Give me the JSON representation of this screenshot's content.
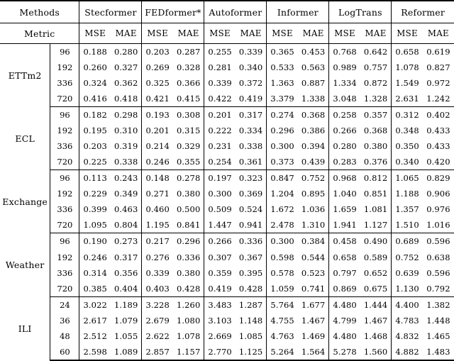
{
  "table": {
    "corner_label": "Methods",
    "metric_row_label": "Metric",
    "models": [
      "Stecformer",
      "FEDformer*",
      "Autoformer",
      "Informer",
      "LogTrans",
      "Reformer"
    ],
    "metrics": [
      "MSE",
      "MAE"
    ],
    "blocks": [
      {
        "dataset": "ETTm2",
        "rows": [
          {
            "horizon": "96",
            "values": [
              "0.188",
              "0.280",
              "0.203",
              "0.287",
              "0.255",
              "0.339",
              "0.365",
              "0.453",
              "0.768",
              "0.642",
              "0.658",
              "0.619"
            ],
            "bold": [
              true,
              true,
              false,
              false,
              false,
              false,
              false,
              false,
              false,
              false,
              false,
              false
            ]
          },
          {
            "horizon": "192",
            "values": [
              "0.260",
              "0.327",
              "0.269",
              "0.328",
              "0.281",
              "0.340",
              "0.533",
              "0.563",
              "0.989",
              "0.757",
              "1.078",
              "0.827"
            ],
            "bold": [
              true,
              true,
              false,
              false,
              false,
              false,
              false,
              false,
              false,
              false,
              false,
              false
            ]
          },
          {
            "horizon": "336",
            "values": [
              "0.324",
              "0.362",
              "0.325",
              "0.366",
              "0.339",
              "0.372",
              "1.363",
              "0.887",
              "1.334",
              "0.872",
              "1.549",
              "0.972"
            ],
            "bold": [
              true,
              true,
              false,
              false,
              false,
              false,
              false,
              false,
              false,
              false,
              false,
              false
            ]
          },
          {
            "horizon": "720",
            "values": [
              "0.416",
              "0.418",
              "0.421",
              "0.415",
              "0.422",
              "0.419",
              "3.379",
              "1.338",
              "3.048",
              "1.328",
              "2.631",
              "1.242"
            ],
            "bold": [
              true,
              false,
              false,
              true,
              false,
              false,
              false,
              false,
              false,
              false,
              false,
              false
            ]
          }
        ]
      },
      {
        "dataset": "ECL",
        "rows": [
          {
            "horizon": "96",
            "values": [
              "0.182",
              "0.298",
              "0.193",
              "0.308",
              "0.201",
              "0.317",
              "0.274",
              "0.368",
              "0.258",
              "0.357",
              "0.312",
              "0.402"
            ],
            "bold": [
              true,
              true,
              false,
              false,
              false,
              false,
              false,
              false,
              false,
              false,
              false,
              false
            ]
          },
          {
            "horizon": "192",
            "values": [
              "0.195",
              "0.310",
              "0.201",
              "0.315",
              "0.222",
              "0.334",
              "0.296",
              "0.386",
              "0.266",
              "0.368",
              "0.348",
              "0.433"
            ],
            "bold": [
              true,
              true,
              false,
              false,
              false,
              false,
              false,
              false,
              false,
              false,
              false,
              false
            ]
          },
          {
            "horizon": "336",
            "values": [
              "0.203",
              "0.319",
              "0.214",
              "0.329",
              "0.231",
              "0.338",
              "0.300",
              "0.394",
              "0.280",
              "0.380",
              "0.350",
              "0.433"
            ],
            "bold": [
              true,
              true,
              false,
              false,
              false,
              false,
              false,
              false,
              false,
              false,
              false,
              false
            ]
          },
          {
            "horizon": "720",
            "values": [
              "0.225",
              "0.338",
              "0.246",
              "0.355",
              "0.254",
              "0.361",
              "0.373",
              "0.439",
              "0.283",
              "0.376",
              "0.340",
              "0.420"
            ],
            "bold": [
              true,
              true,
              false,
              false,
              false,
              false,
              false,
              false,
              false,
              false,
              false,
              false
            ]
          }
        ]
      },
      {
        "dataset": "Exchange",
        "rows": [
          {
            "horizon": "96",
            "values": [
              "0.113",
              "0.243",
              "0.148",
              "0.278",
              "0.197",
              "0.323",
              "0.847",
              "0.752",
              "0.968",
              "0.812",
              "1.065",
              "0.829"
            ],
            "bold": [
              true,
              true,
              false,
              false,
              false,
              false,
              false,
              false,
              false,
              false,
              false,
              false
            ]
          },
          {
            "horizon": "192",
            "values": [
              "0.229",
              "0.349",
              "0.271",
              "0.380",
              "0.300",
              "0.369",
              "1.204",
              "0.895",
              "1.040",
              "0.851",
              "1.188",
              "0.906"
            ],
            "bold": [
              true,
              true,
              false,
              false,
              false,
              false,
              false,
              false,
              false,
              false,
              false,
              false
            ]
          },
          {
            "horizon": "336",
            "values": [
              "0.399",
              "0.463",
              "0.460",
              "0.500",
              "0.509",
              "0.524",
              "1.672",
              "1.036",
              "1.659",
              "1.081",
              "1.357",
              "0.976"
            ],
            "bold": [
              true,
              true,
              false,
              false,
              false,
              false,
              false,
              false,
              false,
              false,
              false,
              false
            ]
          },
          {
            "horizon": "720",
            "values": [
              "1.095",
              "0.804",
              "1.195",
              "0.841",
              "1.447",
              "0.941",
              "2.478",
              "1.310",
              "1.941",
              "1.127",
              "1.510",
              "1.016"
            ],
            "bold": [
              true,
              true,
              false,
              false,
              false,
              false,
              false,
              false,
              false,
              false,
              false,
              false
            ]
          }
        ]
      },
      {
        "dataset": "Weather",
        "rows": [
          {
            "horizon": "96",
            "values": [
              "0.190",
              "0.273",
              "0.217",
              "0.296",
              "0.266",
              "0.336",
              "0.300",
              "0.384",
              "0.458",
              "0.490",
              "0.689",
              "0.596"
            ],
            "bold": [
              true,
              true,
              false,
              false,
              false,
              false,
              false,
              false,
              false,
              false,
              false,
              false
            ]
          },
          {
            "horizon": "192",
            "values": [
              "0.246",
              "0.317",
              "0.276",
              "0.336",
              "0.307",
              "0.367",
              "0.598",
              "0.544",
              "0.658",
              "0.589",
              "0.752",
              "0.638"
            ],
            "bold": [
              true,
              true,
              false,
              false,
              false,
              false,
              false,
              false,
              false,
              false,
              false,
              false
            ]
          },
          {
            "horizon": "336",
            "values": [
              "0.314",
              "0.356",
              "0.339",
              "0.380",
              "0.359",
              "0.395",
              "0.578",
              "0.523",
              "0.797",
              "0.652",
              "0.639",
              "0.596"
            ],
            "bold": [
              true,
              true,
              false,
              false,
              false,
              false,
              false,
              false,
              false,
              false,
              false,
              false
            ]
          },
          {
            "horizon": "720",
            "values": [
              "0.385",
              "0.404",
              "0.403",
              "0.428",
              "0.419",
              "0.428",
              "1.059",
              "0.741",
              "0.869",
              "0.675",
              "1.130",
              "0.792"
            ],
            "bold": [
              true,
              true,
              false,
              false,
              false,
              false,
              false,
              false,
              false,
              false,
              false,
              false
            ]
          }
        ]
      },
      {
        "dataset": "ILI",
        "rows": [
          {
            "horizon": "24",
            "values": [
              "3.022",
              "1.189",
              "3.228",
              "1.260",
              "3.483",
              "1.287",
              "5.764",
              "1.677",
              "4.480",
              "1.444",
              "4.400",
              "1.382"
            ],
            "bold": [
              true,
              true,
              false,
              false,
              false,
              false,
              false,
              false,
              false,
              false,
              false,
              false
            ]
          },
          {
            "horizon": "36",
            "values": [
              "2.617",
              "1.079",
              "2.679",
              "1.080",
              "3.103",
              "1.148",
              "4.755",
              "1.467",
              "4.799",
              "1.467",
              "4.783",
              "1.448"
            ],
            "bold": [
              true,
              true,
              false,
              false,
              false,
              false,
              false,
              false,
              false,
              false,
              false,
              false
            ]
          },
          {
            "horizon": "48",
            "values": [
              "2.512",
              "1.055",
              "2.622",
              "1.078",
              "2.669",
              "1.085",
              "4.763",
              "1.469",
              "4.480",
              "1.468",
              "4.832",
              "1.465"
            ],
            "bold": [
              true,
              true,
              false,
              false,
              false,
              false,
              false,
              false,
              false,
              false,
              false,
              false
            ]
          },
          {
            "horizon": "60",
            "values": [
              "2.598",
              "1.089",
              "2.857",
              "1.157",
              "2.770",
              "1.125",
              "5.264",
              "1.564",
              "5.278",
              "1.560",
              "4.882",
              "1.483"
            ],
            "bold": [
              true,
              true,
              false,
              false,
              false,
              false,
              false,
              false,
              false,
              false,
              false,
              false
            ]
          }
        ]
      }
    ]
  }
}
